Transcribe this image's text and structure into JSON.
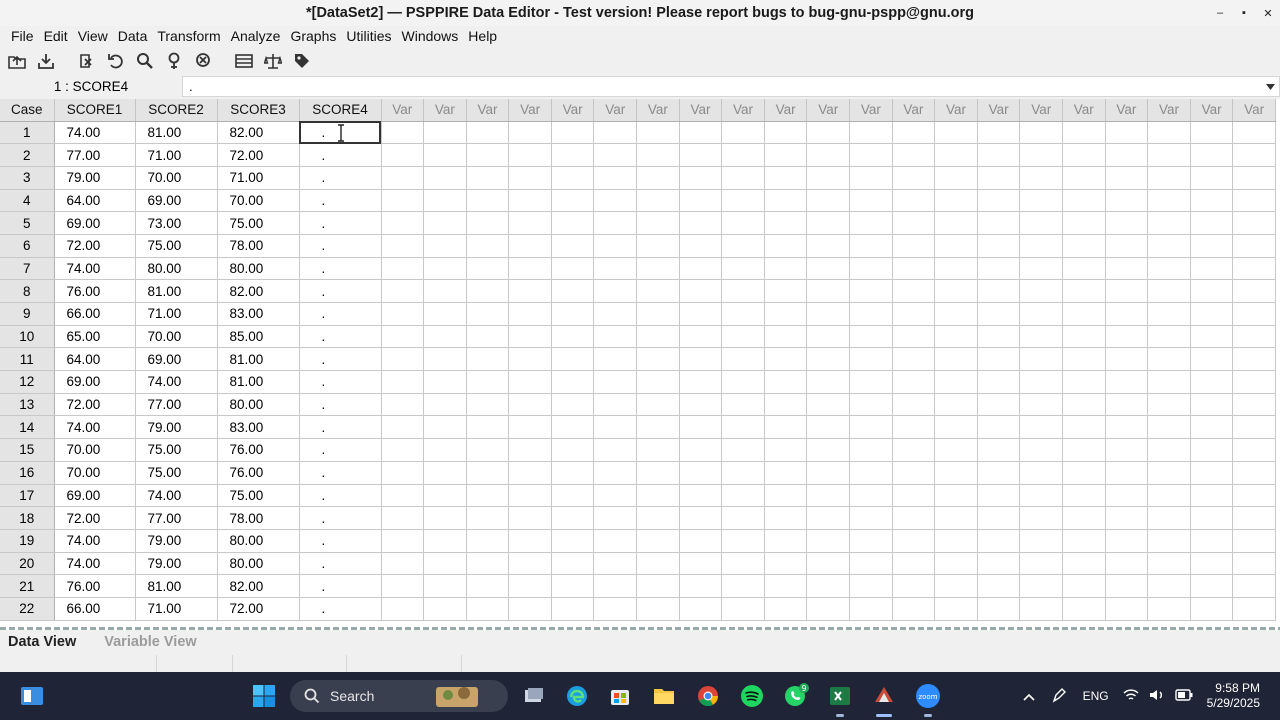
{
  "window": {
    "title": "*[DataSet2] — PSPPIRE Data Editor - Test version! Please report bugs to bug-gnu-pspp@gnu.org",
    "minimize": "–",
    "maximize": "▪",
    "close": "✕"
  },
  "menu": [
    "File",
    "Edit",
    "View",
    "Data",
    "Transform",
    "Analyze",
    "Graphs",
    "Utilities",
    "Windows",
    "Help"
  ],
  "toolbar_icons": [
    "open-icon",
    "save-icon",
    "goto-case-icon",
    "undo-icon",
    "redo-icon",
    "find-icon",
    "goto-variable-icon",
    "delete-icon",
    "split-file-icon",
    "weight-cases-icon",
    "value-labels-icon"
  ],
  "cell_ref": {
    "name": "1 : SCORE4",
    "value": "."
  },
  "grid": {
    "case_header": "Case",
    "columns": [
      "SCORE1",
      "SCORE2",
      "SCORE3",
      "SCORE4"
    ],
    "var_label": "Var",
    "var_count": 21,
    "rows": [
      [
        "1",
        "74.00",
        "81.00",
        "82.00",
        "."
      ],
      [
        "2",
        "77.00",
        "71.00",
        "72.00",
        "."
      ],
      [
        "3",
        "79.00",
        "70.00",
        "71.00",
        "."
      ],
      [
        "4",
        "64.00",
        "69.00",
        "70.00",
        "."
      ],
      [
        "5",
        "69.00",
        "73.00",
        "75.00",
        "."
      ],
      [
        "6",
        "72.00",
        "75.00",
        "78.00",
        "."
      ],
      [
        "7",
        "74.00",
        "80.00",
        "80.00",
        "."
      ],
      [
        "8",
        "76.00",
        "81.00",
        "82.00",
        "."
      ],
      [
        "9",
        "66.00",
        "71.00",
        "83.00",
        "."
      ],
      [
        "10",
        "65.00",
        "70.00",
        "85.00",
        "."
      ],
      [
        "11",
        "64.00",
        "69.00",
        "81.00",
        "."
      ],
      [
        "12",
        "69.00",
        "74.00",
        "81.00",
        "."
      ],
      [
        "13",
        "72.00",
        "77.00",
        "80.00",
        "."
      ],
      [
        "14",
        "74.00",
        "79.00",
        "83.00",
        "."
      ],
      [
        "15",
        "70.00",
        "75.00",
        "76.00",
        "."
      ],
      [
        "16",
        "70.00",
        "75.00",
        "76.00",
        "."
      ],
      [
        "17",
        "69.00",
        "74.00",
        "75.00",
        "."
      ],
      [
        "18",
        "72.00",
        "77.00",
        "78.00",
        "."
      ],
      [
        "19",
        "74.00",
        "79.00",
        "80.00",
        "."
      ],
      [
        "20",
        "74.00",
        "79.00",
        "80.00",
        "."
      ],
      [
        "21",
        "76.00",
        "81.00",
        "82.00",
        "."
      ],
      [
        "22",
        "66.00",
        "71.00",
        "72.00",
        "."
      ]
    ]
  },
  "tabs": {
    "data_view": "Data View",
    "variable_view": "Variable View"
  },
  "taskbar": {
    "search_label": "Search",
    "language": "ENG",
    "time": "9:58 PM",
    "date": "5/29/2025",
    "whatsapp_badge": "9",
    "zoom_label": "zoom"
  }
}
